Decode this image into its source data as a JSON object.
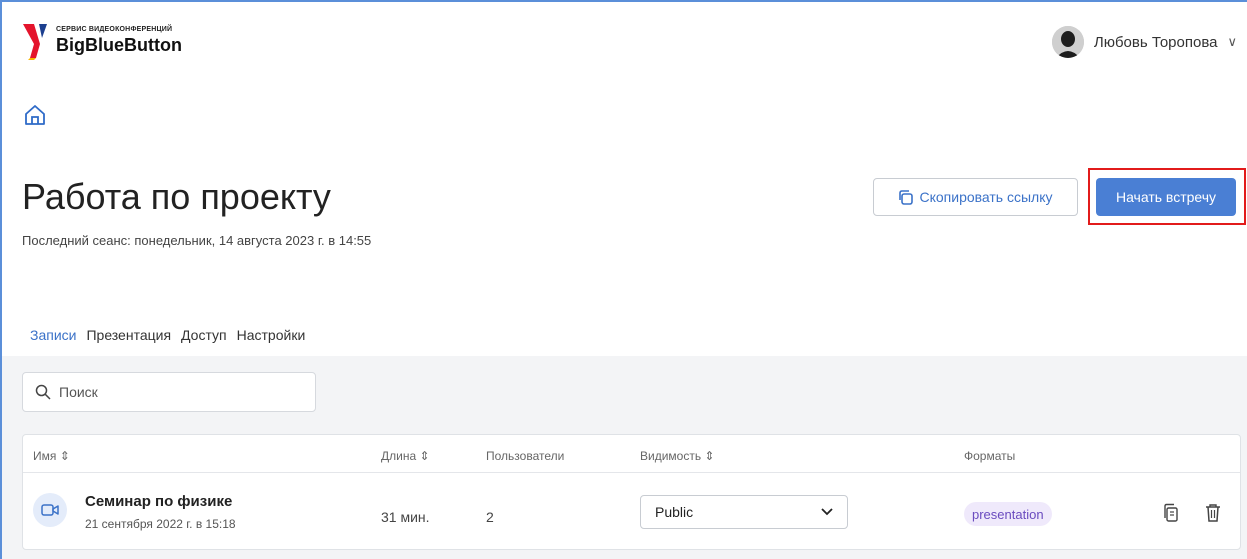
{
  "header": {
    "logo_sub": "СЕРВИС ВИДЕОКОНФЕРЕНЦИЙ",
    "logo_title": "BigBlueButton",
    "user_name": "Любовь Торопова",
    "user_chevron": "∨"
  },
  "room": {
    "title": "Работа по проекту",
    "last_session": "Последний сеанс: понедельник, 14 августа 2023 г. в 14:55",
    "copy_link_label": "Скопировать ссылку",
    "start_meeting_label": "Начать встречу"
  },
  "tabs": [
    {
      "label": "Записи",
      "active": true
    },
    {
      "label": "Презентация",
      "active": false
    },
    {
      "label": "Доступ",
      "active": false
    },
    {
      "label": "Настройки",
      "active": false
    }
  ],
  "search": {
    "placeholder": "Поиск"
  },
  "table": {
    "headers": {
      "name": "Имя ⇕",
      "length": "Длина ⇕",
      "users": "Пользователи",
      "visibility": "Видимость ⇕",
      "formats": "Форматы"
    },
    "rows": [
      {
        "name": "Семинар по физике",
        "date": "21 сентября 2022 г. в 15:18",
        "length": "31 мин.",
        "users": "2",
        "visibility": "Public",
        "format": "presentation"
      }
    ]
  },
  "colors": {
    "accent": "#4a7fd4",
    "highlight_box": "#e21b1b",
    "badge_bg": "#efe9fb",
    "badge_text": "#6a4bbf"
  },
  "icons": {
    "home": "home-icon",
    "copy": "copy-icon",
    "search": "search-icon",
    "video": "video-icon",
    "copy_row": "copy-row-icon",
    "delete": "trash-icon",
    "select_chevron": "chevron-down-icon"
  }
}
